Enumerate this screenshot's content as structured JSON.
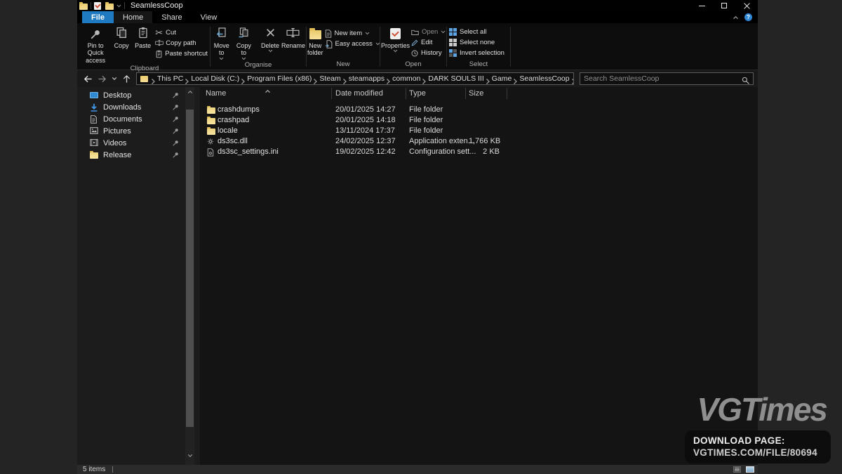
{
  "window": {
    "title": "SeamlessCoop"
  },
  "tabs": {
    "file": "File",
    "home": "Home",
    "share": "Share",
    "view": "View"
  },
  "ribbon": {
    "clipboard": {
      "label": "Clipboard",
      "pin_to_quick_access": "Pin to Quick access",
      "copy": "Copy",
      "paste": "Paste",
      "cut": "Cut",
      "copy_path": "Copy path",
      "paste_shortcut": "Paste shortcut"
    },
    "organise": {
      "label": "Organise",
      "move_to": "Move to",
      "copy_to": "Copy to",
      "delete": "Delete",
      "rename": "Rename"
    },
    "new": {
      "label": "New",
      "new_folder": "New folder",
      "new_item": "New item",
      "easy_access": "Easy access"
    },
    "open": {
      "label": "Open",
      "properties": "Properties",
      "open": "Open",
      "edit": "Edit",
      "history": "History"
    },
    "select": {
      "label": "Select",
      "select_all": "Select all",
      "select_none": "Select none",
      "invert_selection": "Invert selection"
    }
  },
  "addressbar": {
    "crumbs": [
      "This PC",
      "Local Disk (C:)",
      "Program Files (x86)",
      "Steam",
      "steamapps",
      "common",
      "DARK SOULS III",
      "Game",
      "SeamlessCoop"
    ],
    "search_placeholder": "Search SeamlessCoop"
  },
  "sidebar": {
    "items": [
      {
        "label": "Desktop",
        "icon": "desktop",
        "pinned": true
      },
      {
        "label": "Downloads",
        "icon": "downloads",
        "pinned": true
      },
      {
        "label": "Documents",
        "icon": "documents",
        "pinned": true
      },
      {
        "label": "Pictures",
        "icon": "pictures",
        "pinned": true
      },
      {
        "label": "Videos",
        "icon": "videos",
        "pinned": true
      },
      {
        "label": "Release",
        "icon": "folder",
        "pinned": true
      }
    ]
  },
  "filelist": {
    "columns": {
      "name": "Name",
      "date_modified": "Date modified",
      "type": "Type",
      "size": "Size"
    },
    "rows": [
      {
        "name": "crashdumps",
        "date": "20/01/2025 14:27",
        "type": "File folder",
        "size": "",
        "icon": "folder"
      },
      {
        "name": "crashpad",
        "date": "20/01/2025 14:18",
        "type": "File folder",
        "size": "",
        "icon": "folder"
      },
      {
        "name": "locale",
        "date": "13/11/2024 17:37",
        "type": "File folder",
        "size": "",
        "icon": "folder"
      },
      {
        "name": "ds3sc.dll",
        "date": "24/02/2025 12:37",
        "type": "Application exten...",
        "size": "1,766 KB",
        "icon": "dll"
      },
      {
        "name": "ds3sc_settings.ini",
        "date": "19/02/2025 12:42",
        "type": "Configuration sett...",
        "size": "2 KB",
        "icon": "ini"
      }
    ]
  },
  "statusbar": {
    "count": "5 items"
  },
  "watermark": {
    "logo": "VGTimes",
    "line1": "DOWNLOAD PAGE:",
    "line2": "VGTIMES.COM/FILE/80694"
  },
  "glyphs": {
    "cut": "✂",
    "help": "?"
  },
  "colors": {
    "accent_blue": "#1f7ac1",
    "help_blue": "#2f87d5",
    "folder_yellow": "#f0d078",
    "select_icon_blue": "#5ea2e0",
    "desktop_bg": "#242424"
  }
}
